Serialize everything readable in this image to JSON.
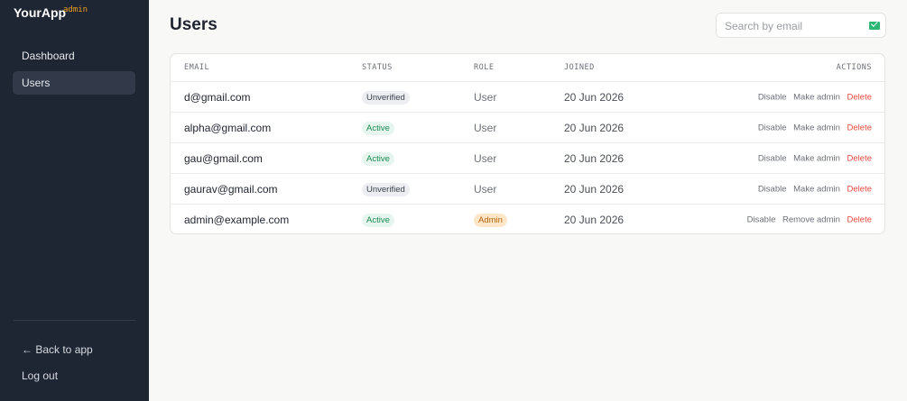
{
  "app": {
    "name": "YourApp",
    "badge": "admin"
  },
  "sidebar": {
    "items": [
      {
        "label": "Dashboard",
        "active": false
      },
      {
        "label": "Users",
        "active": true
      }
    ],
    "back_label": "← Back to app",
    "logout_label": "Log out"
  },
  "page": {
    "title": "Users"
  },
  "search": {
    "placeholder": "Search by email",
    "value": "",
    "icon": "envelope-icon"
  },
  "table": {
    "headers": {
      "email": "EMAIL",
      "status": "STATUS",
      "role": "ROLE",
      "joined": "JOINED",
      "actions": "ACTIONS"
    },
    "rows": [
      {
        "email": "d@gmail.com",
        "status": "Unverified",
        "role": "User",
        "joined": "20 Jun 2026",
        "toggle_label": "Disable",
        "admin_label": "Make admin",
        "delete_label": "Delete"
      },
      {
        "email": "alpha@gmail.com",
        "status": "Active",
        "role": "User",
        "joined": "20 Jun 2026",
        "toggle_label": "Disable",
        "admin_label": "Make admin",
        "delete_label": "Delete"
      },
      {
        "email": "gau@gmail.com",
        "status": "Active",
        "role": "User",
        "joined": "20 Jun 2026",
        "toggle_label": "Disable",
        "admin_label": "Make admin",
        "delete_label": "Delete"
      },
      {
        "email": "gaurav@gmail.com",
        "status": "Unverified",
        "role": "User",
        "joined": "20 Jun 2026",
        "toggle_label": "Disable",
        "admin_label": "Make admin",
        "delete_label": "Delete"
      },
      {
        "email": "admin@example.com",
        "status": "Active",
        "role": "Admin",
        "joined": "20 Jun 2026",
        "toggle_label": "Disable",
        "admin_label": "Remove admin",
        "delete_label": "Delete"
      }
    ]
  },
  "colors": {
    "sidebar_bg": "#1e2533",
    "accent": "#f0a020",
    "danger": "#e5483e",
    "active_status": "#1d8a52"
  }
}
